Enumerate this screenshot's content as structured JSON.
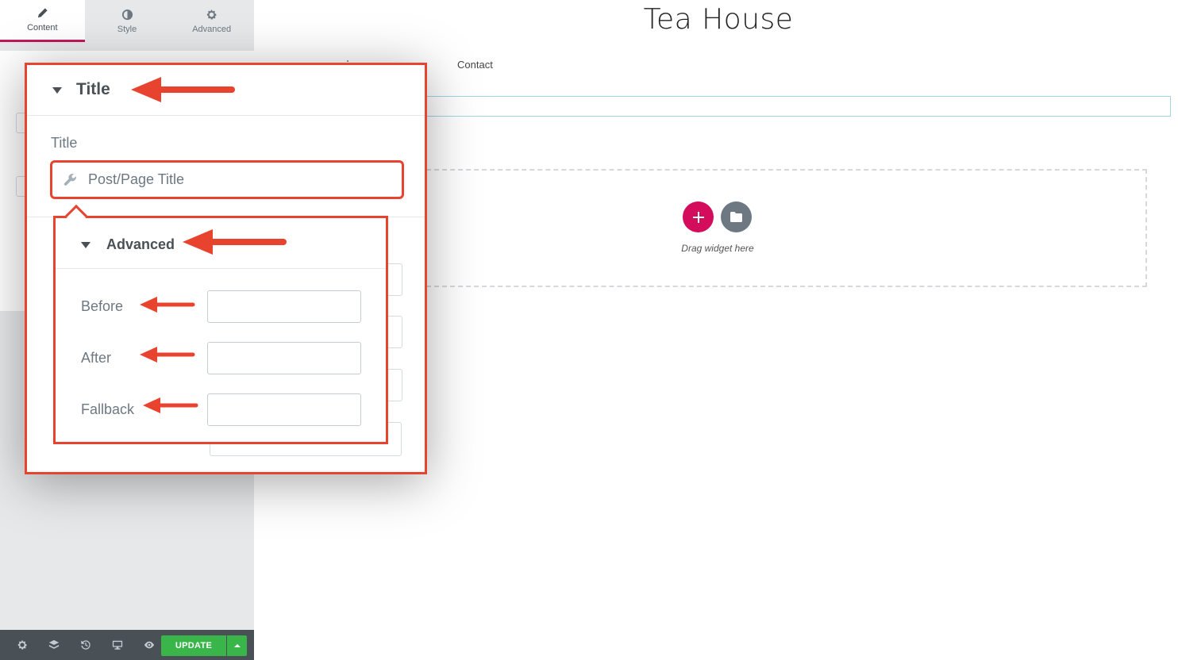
{
  "panel": {
    "tabs": [
      {
        "label": "Content",
        "icon": "pencil-icon"
      },
      {
        "label": "Style",
        "icon": "contrast-icon"
      },
      {
        "label": "Advanced",
        "icon": "gear-icon"
      }
    ],
    "bottom_bar": {
      "icons": [
        "gear-icon",
        "layers-icon",
        "history-icon",
        "desktop-icon",
        "eye-icon"
      ],
      "update_label": "UPDATE"
    }
  },
  "preview": {
    "site_title": "Tea House",
    "nav_contact": "Contact",
    "drag_hint": "Drag widget here"
  },
  "popup": {
    "section_title": "Title",
    "field_label": "Title",
    "dynamic_value": "Post/Page Title",
    "advanced": {
      "title": "Advanced",
      "fields": [
        {
          "label": "Before",
          "value": ""
        },
        {
          "label": "After",
          "value": ""
        },
        {
          "label": "Fallback",
          "value": ""
        }
      ]
    }
  },
  "colors": {
    "accent_pink": "#c2185b",
    "add_button": "#d30c5c",
    "update_green": "#39b54a",
    "highlight_red": "#e8432e"
  }
}
